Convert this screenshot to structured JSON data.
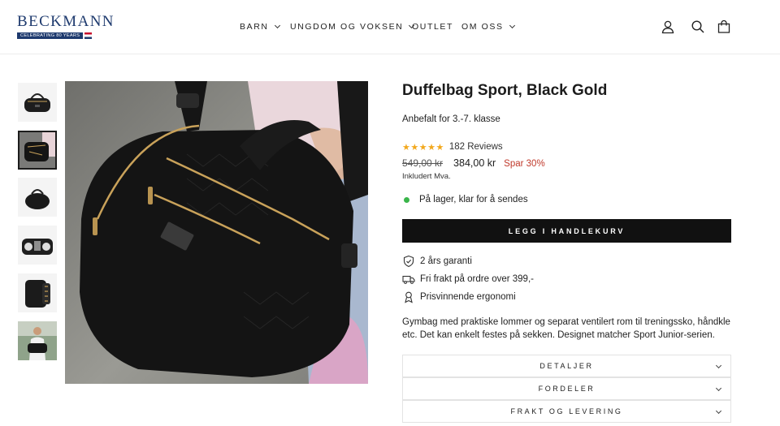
{
  "brand": {
    "name": "BECKMANN",
    "tagline": "CELEBRATING 80 YEARS",
    "colors": {
      "navy": "#1e3a6e",
      "red": "#c8102e"
    }
  },
  "nav": {
    "items": [
      {
        "label": "BARN",
        "has_dropdown": true
      },
      {
        "label": "UNGDOM OG VOKSEN",
        "has_dropdown": true
      },
      {
        "label": "OUTLET",
        "has_dropdown": false
      },
      {
        "label": "OM OSS",
        "has_dropdown": true
      }
    ]
  },
  "header_icons": [
    "user-icon",
    "search-icon",
    "cart-icon"
  ],
  "gallery": {
    "thumbnails": [
      {
        "icon": "duffel-black-thumbnail",
        "active": false
      },
      {
        "icon": "duffel-carried-thumbnail",
        "active": true
      },
      {
        "icon": "duffel-side-thumbnail",
        "active": false
      },
      {
        "icon": "duffel-open-thumbnail",
        "active": false
      },
      {
        "icon": "duffel-pockets-thumbnail",
        "active": false
      },
      {
        "icon": "model-with-bag-thumbnail",
        "active": false
      }
    ]
  },
  "product": {
    "title": "Duffelbag Sport, Black Gold",
    "recommendation": "Anbefalt for 3.-7. klasse",
    "rating_stars": 5,
    "reviews": "182 Reviews",
    "old_price": "549,00 kr",
    "price": "384,00 kr",
    "discount": "Spar 30%",
    "vat_note": "Inkludert Mva.",
    "stock": "På lager, klar for å sendes",
    "add_to_cart": "LEGG I HANDLEKURV",
    "features": [
      {
        "icon": "shield-check-icon",
        "text": "2 års garanti"
      },
      {
        "icon": "truck-icon",
        "text": "Fri frakt på ordre over 399,-"
      },
      {
        "icon": "ergonomic-icon",
        "text": "Prisvinnende ergonomi"
      }
    ],
    "description": "Gymbag med praktiske lommer og separat ventilert rom til treningssko, håndkle etc. Det kan enkelt festes på sekken. Designet matcher Sport Junior-serien.",
    "accordions": [
      "DETALJER",
      "FORDELER",
      "FRAKT OG LEVERING"
    ]
  },
  "colors": {
    "stars": "#f2a81d",
    "discount": "#c0392b",
    "in_stock": "#3ab54a",
    "button": "#111111"
  }
}
